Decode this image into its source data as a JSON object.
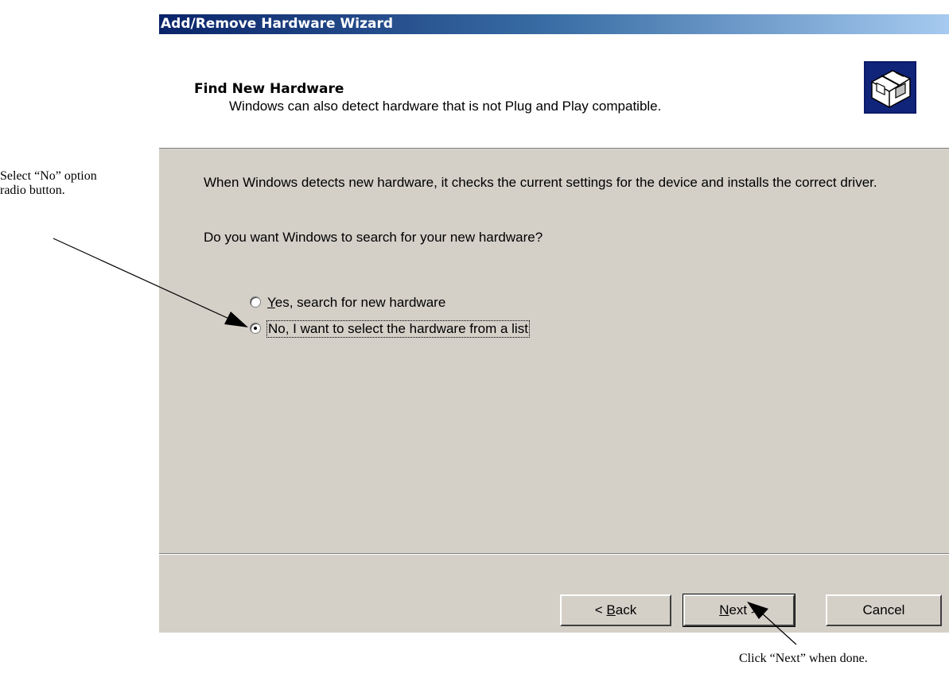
{
  "annotations": {
    "left_callout": "Select “No” option radio button.",
    "right_callout": "Click “Next” when done."
  },
  "window": {
    "title": "Add/Remove Hardware Wizard"
  },
  "header": {
    "title": "Find New Hardware",
    "subtitle": "Windows can also detect hardware that is not Plug and Play compatible.",
    "icon": "hardware-card-icon"
  },
  "content": {
    "description": "When Windows detects new hardware, it checks the current settings for the device and installs the correct driver.",
    "question": "Do you want Windows to search for your new hardware?",
    "options": [
      {
        "mnemonic": "Y",
        "rest": "es, search for new hardware",
        "selected": false
      },
      {
        "mnemonic": "",
        "rest": "No, I want to select the hardware from a list",
        "selected": true
      }
    ]
  },
  "buttons": {
    "back_prefix": "< ",
    "back_mnemonic": "B",
    "back_rest": "ack",
    "next_mnemonic": "N",
    "next_rest": "ext >",
    "cancel": "Cancel"
  },
  "colors": {
    "title_bar_start": "#0a246a",
    "title_bar_end": "#a6caf0",
    "dialog_face": "#d4d0c8",
    "header_background": "#ffffff"
  }
}
